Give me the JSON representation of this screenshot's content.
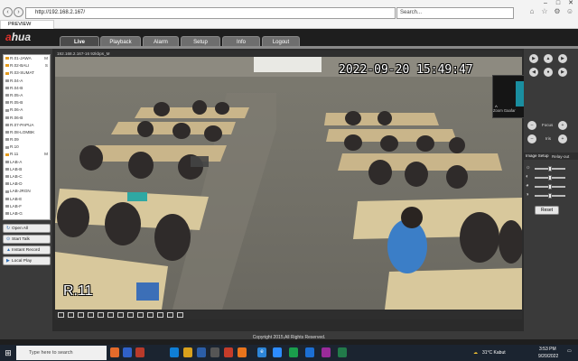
{
  "browser": {
    "address": "http://192.168.2.167/",
    "search_placeholder": "Search...",
    "tab_title": "PREVIEW",
    "win_min": "–",
    "win_max": "□",
    "win_close": "✕"
  },
  "app": {
    "logo_prefix": "a",
    "logo_rest": "hua",
    "nav_tabs": [
      "Live",
      "Playback",
      "Alarm",
      "Setup",
      "Info",
      "Logout"
    ],
    "active_tab": "Live"
  },
  "channels": [
    {
      "label": "R.01-JAWA",
      "flag": "M",
      "on": true
    },
    {
      "label": "R.02-BALI",
      "flag": "S",
      "on": true
    },
    {
      "label": "R.03-SUMAT",
      "flag": "",
      "on": true
    },
    {
      "label": "R.04-A",
      "flag": "",
      "on": false
    },
    {
      "label": "R.04-B",
      "flag": "",
      "on": false
    },
    {
      "label": "R.05-A",
      "flag": "",
      "on": false
    },
    {
      "label": "R.05-B",
      "flag": "",
      "on": false
    },
    {
      "label": "R.06-A",
      "flag": "",
      "on": false
    },
    {
      "label": "R.06-B",
      "flag": "",
      "on": false
    },
    {
      "label": "R.07-PAPUA",
      "flag": "",
      "on": false
    },
    {
      "label": "R.08-LOMBK",
      "flag": "",
      "on": false
    },
    {
      "label": "R.09",
      "flag": "",
      "on": false
    },
    {
      "label": "R.10",
      "flag": "",
      "on": false
    },
    {
      "label": "R.11",
      "flag": "M",
      "on": true
    },
    {
      "label": "LAB-A",
      "flag": "",
      "on": false
    },
    {
      "label": "LAB-B",
      "flag": "",
      "on": false
    },
    {
      "label": "LAB-C",
      "flag": "",
      "on": false
    },
    {
      "label": "LAB-D",
      "flag": "",
      "on": false
    },
    {
      "label": "LAB-JRGN",
      "flag": "",
      "on": false
    },
    {
      "label": "LAB-E",
      "flag": "",
      "on": false
    },
    {
      "label": "LAB-F",
      "flag": "",
      "on": false
    },
    {
      "label": "LAB-G",
      "flag": "",
      "on": false
    }
  ],
  "side_buttons": [
    "Open All",
    "Start Talk",
    "Instant Record",
    "Local Play"
  ],
  "video": {
    "info_bar": "192.168.2.167-16 92kbps_M",
    "timestamp": "2022-09-20 15:49:47",
    "camera_name": "R.11"
  },
  "zoom": {
    "initial": "Z",
    "name": "Zoom Gaafar"
  },
  "ptz": {
    "focus_label": "Focus",
    "iris_label": "Iris",
    "image_setup": "Image Setup",
    "relay_out": "Relay-out",
    "reset": "Reset",
    "sliders": [
      0.5,
      0.5,
      0.5,
      0.5
    ]
  },
  "footer": {
    "copyright": "Copyright 2015,All Rights Reserved."
  },
  "taskbar": {
    "search_placeholder": "Type here to search",
    "weather": "31°C  Kabut",
    "time": "3:53 PM",
    "date": "9/20/2022"
  },
  "colors": {
    "accent": "#e0322c",
    "camera_on": "#e39b1f",
    "zoom": "#1a8ea0"
  }
}
